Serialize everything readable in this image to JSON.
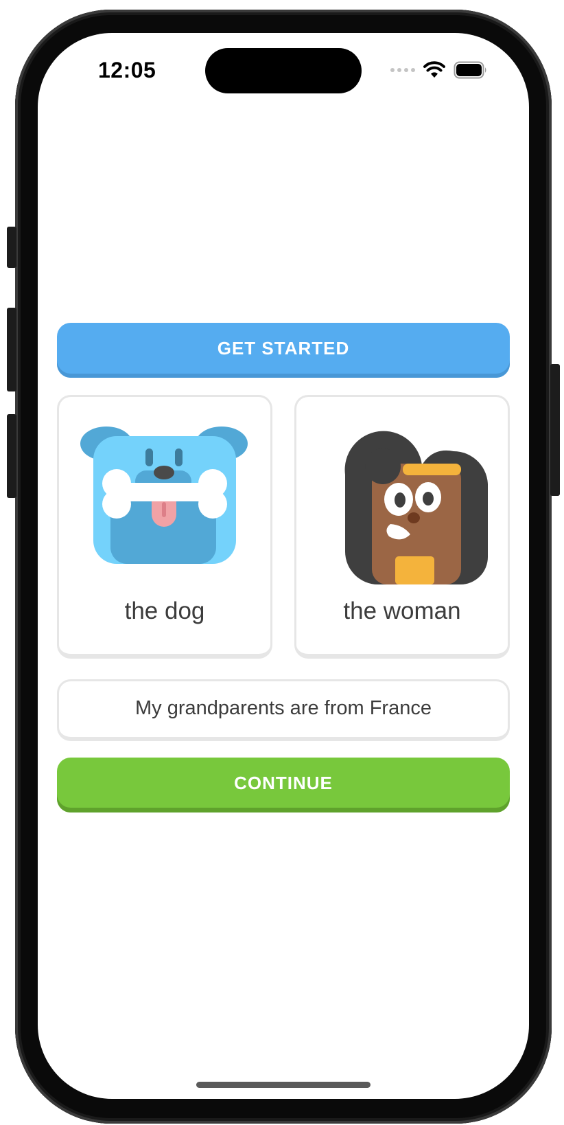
{
  "status_bar": {
    "time": "12:05",
    "icons": [
      "signal-dots-icon",
      "wifi-icon",
      "battery-icon"
    ]
  },
  "get_started": {
    "label": "GET STARTED",
    "color": "#55acf0"
  },
  "cards": [
    {
      "label": "the dog",
      "icon": "dog-with-bone-icon"
    },
    {
      "label": "the woman",
      "icon": "woman-avatar-icon"
    }
  ],
  "sentence": {
    "text": "My grandparents are from France"
  },
  "continue": {
    "label": "CONTINUE",
    "color": "#78c83c"
  }
}
